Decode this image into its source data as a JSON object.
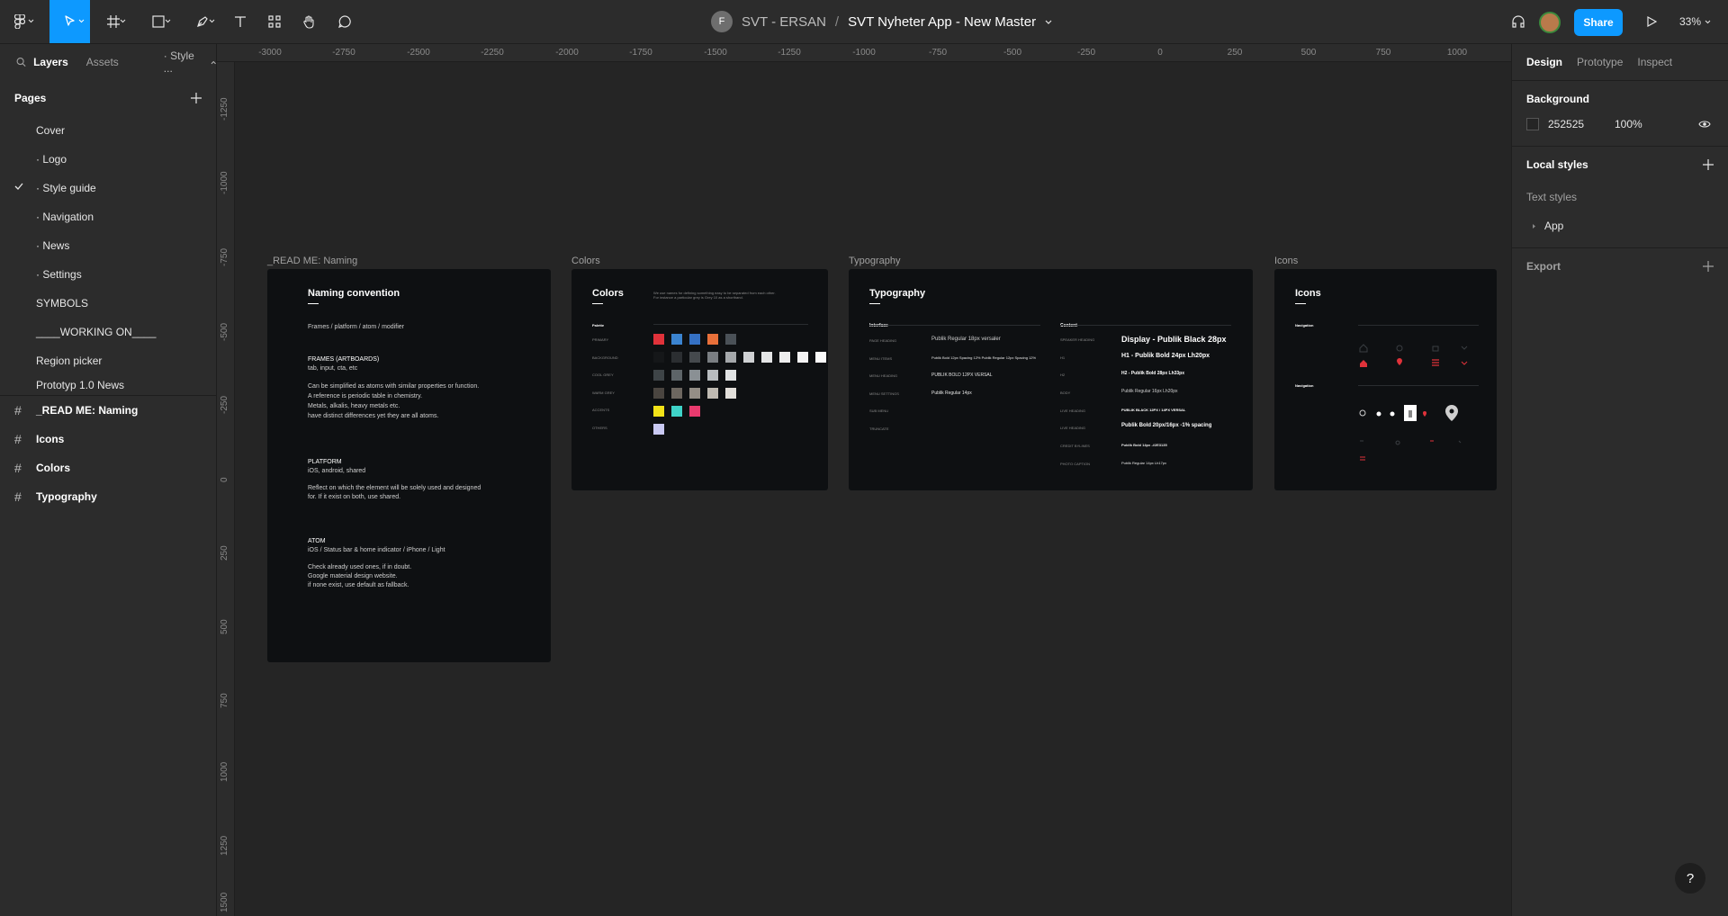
{
  "toolbar": {
    "team_initial": "F",
    "team_name": "SVT - ERSAN",
    "separator": "/",
    "file_name": "SVT Nyheter App - New Master",
    "share_label": "Share",
    "zoom_label": "33%"
  },
  "left_panel": {
    "tabs": [
      "Layers",
      "Assets"
    ],
    "page_selector": "· Style ...",
    "pages_heading": "Pages",
    "pages": [
      {
        "label": "Cover"
      },
      {
        "label": "· Logo"
      },
      {
        "label": "· Style guide",
        "current": true
      },
      {
        "label": "· Navigation"
      },
      {
        "label": "· News"
      },
      {
        "label": "· Settings"
      },
      {
        "label": "SYMBOLS"
      },
      {
        "label": "____WORKING ON____"
      },
      {
        "label": "Region picker"
      },
      {
        "label": "Prototyp 1.0 News"
      }
    ],
    "layers": [
      {
        "label": "_READ ME: Naming"
      },
      {
        "label": "Icons"
      },
      {
        "label": "Colors"
      },
      {
        "label": "Typography"
      }
    ]
  },
  "rulers": {
    "top": [
      "-3000",
      "-2750",
      "-2500",
      "-2250",
      "-2000",
      "-1750",
      "-1500",
      "-1250",
      "-1000",
      "-750",
      "-500",
      "-250",
      "0",
      "250",
      "500",
      "750",
      "1000"
    ],
    "left": [
      "-1250",
      "-1000",
      "-750",
      "-500",
      "-250",
      "0",
      "250",
      "500",
      "750",
      "1000",
      "1250",
      "1500"
    ]
  },
  "canvas": {
    "frames": {
      "readme": {
        "label": "_READ ME: Naming",
        "title": "Naming convention",
        "line1": "Frames / platform / atom / modifier",
        "frames_head": "FRAMES (ARTBOARDS)",
        "frames_sub": "tab, input, cta, etc",
        "para1": [
          "Can be simplified as atoms with similar properties or function.",
          "A reference is periodic table in chemistry.",
          "Metals, alkalis, heavy metals etc.",
          "have distinct differences yet they are all atoms."
        ],
        "platform_head": "PLATFORM",
        "platform_sub": "iOS, android, shared",
        "para2": [
          "Reflect on which the element will be solely used and designed",
          "for. If it exist on both, use shared."
        ],
        "atom_head": "ATOM",
        "atom_sub": "iOS / Status bar & home indicator / iPhone / Light",
        "para3": [
          "Check already used ones, if in doubt.",
          "Google material design website.",
          "if none exist, use default as fallback."
        ]
      },
      "colors": {
        "label": "Colors",
        "title": "Colors",
        "intro": "We use names for defining something easy to be separated from each other. For instance a particular grey is Grey 10 as a shorthand.",
        "palette_label": "Palette",
        "row_labels": [
          "PRIMARY",
          "BACKGROUND",
          "COOL GREY",
          "WARM GREY",
          "ACCENTS",
          "OTHERS"
        ],
        "rows": [
          [
            "#e0323a",
            "#3b84d0",
            "#3571c4",
            "#e8703a",
            "#4a5157"
          ],
          [
            "#151719",
            "#2b2e31",
            "#45494d",
            "#7a7e82",
            "#a5a8ab",
            "#cfd1d3",
            "#e4e5e6",
            "#eeeeee",
            "#f4f4f4",
            "#fafafa"
          ],
          [
            "#3e4447",
            "#5d6468",
            "#8a9094",
            "#b8bcbf",
            "#e1e3e4"
          ],
          [
            "#4a4540",
            "#6d6760",
            "#948e86",
            "#bfbab2",
            "#e2dfda"
          ],
          [
            "#f2e218",
            "#3fd3c8",
            "#e83a6e"
          ],
          [
            "#c9c9f2"
          ]
        ]
      },
      "typography": {
        "label": "Typography",
        "title": "Typography",
        "interface_label": "Interface",
        "content_label": "Content",
        "interface_rows": [
          {
            "name": "PAGE HEADING",
            "sample": "Publik Regular 18px versaler"
          },
          {
            "name": "MENU ITEMS",
            "sample": "Publik Bold 12px Spacing 12%     Publik Regular 12px Spacing 12%"
          },
          {
            "name": "MENU HEADING",
            "sample": "PUBLIK BOLD 12PX VERSAL"
          },
          {
            "name": "MENU SETTINGS",
            "sample": "Publik Regular 14px"
          },
          {
            "name": "SUB MENU",
            "sample": ""
          },
          {
            "name": "TRUNCATE",
            "sample": ""
          }
        ],
        "content_rows": [
          {
            "name": "SPEAKER HEADING",
            "sample": "Display  -  Publik Black 28px"
          },
          {
            "name": "H1",
            "sample": "H1 - Publik Bold 24px Lh20px"
          },
          {
            "name": "H2",
            "sample": "H2 - Publik Bold 28px Lh33px"
          },
          {
            "name": "BODY",
            "sample": "Publik Regular 16px Lh20px"
          },
          {
            "name": "LIVE HEADING",
            "sample": "PUBLIK BLACK 12PX / 14PX VERSAL"
          },
          {
            "name": "LIVE HEADING",
            "sample": "Publik Bold 20px/16px -1% spacing"
          },
          {
            "name": "CREDIT BYLINES",
            "sample": "Publik Bold 14px -#2E3135"
          },
          {
            "name": "PHOTO CAPTION",
            "sample": "Publik Regular 14px Lh17px"
          }
        ]
      },
      "icons": {
        "label": "Icons",
        "title": "Icons",
        "section1": "Navigation",
        "section2": "Navigation"
      }
    }
  },
  "right_panel": {
    "tabs": [
      "Design",
      "Prototype",
      "Inspect"
    ],
    "background_heading": "Background",
    "background_hex": "252525",
    "background_opacity": "100%",
    "local_styles_heading": "Local styles",
    "text_styles_label": "Text styles",
    "text_style_group": "App",
    "export_heading": "Export"
  },
  "help_label": "?",
  "colors": {
    "accent": "#0d99ff",
    "ui_panel": "#2c2c2c",
    "canvas_bg": "#252525",
    "frame_bg": "#0e1012",
    "brand_red": "#e0323a"
  }
}
